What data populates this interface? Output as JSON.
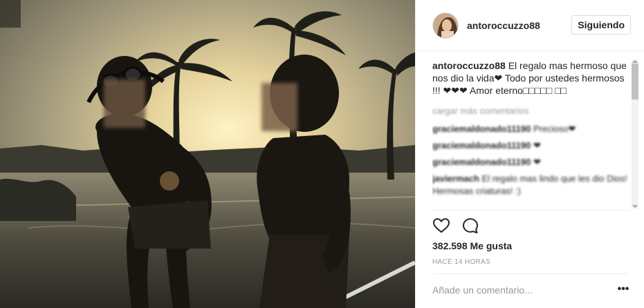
{
  "post": {
    "username": "antoroccuzzo88",
    "follow_label": "Siguiendo"
  },
  "caption": {
    "username": "antoroccuzzo88",
    "text": " El regalo mas hermoso que nos dio la vida❤ Todo por ustedes hermosos !!! ❤❤❤ Amor eterno□□□□□ □□"
  },
  "comments": {
    "load_more": "cargar más comentarios",
    "items": [
      {
        "username": "graciemaldonado11190",
        "text": " Precioso❤"
      },
      {
        "username": "graciemaldonado11190",
        "text": " ❤"
      },
      {
        "username": "graciemaldonado11190",
        "text": " ❤"
      },
      {
        "username": "javiermach",
        "text": " El regalo mas lindo que les dio Dios! Hermosas criaturas! :)"
      }
    ]
  },
  "engagement": {
    "likes_text": "382.598 Me gusta",
    "time_text": "HACE 14 HORAS"
  },
  "compose": {
    "placeholder": "Añade un comentario..."
  },
  "icons": {
    "like": "heart-outline-icon",
    "comment": "speech-bubble-icon",
    "more": "ellipsis-icon"
  },
  "colors": {
    "text": "#262626",
    "muted": "#999999",
    "border": "#dbdbdb",
    "divider": "#efefef"
  }
}
